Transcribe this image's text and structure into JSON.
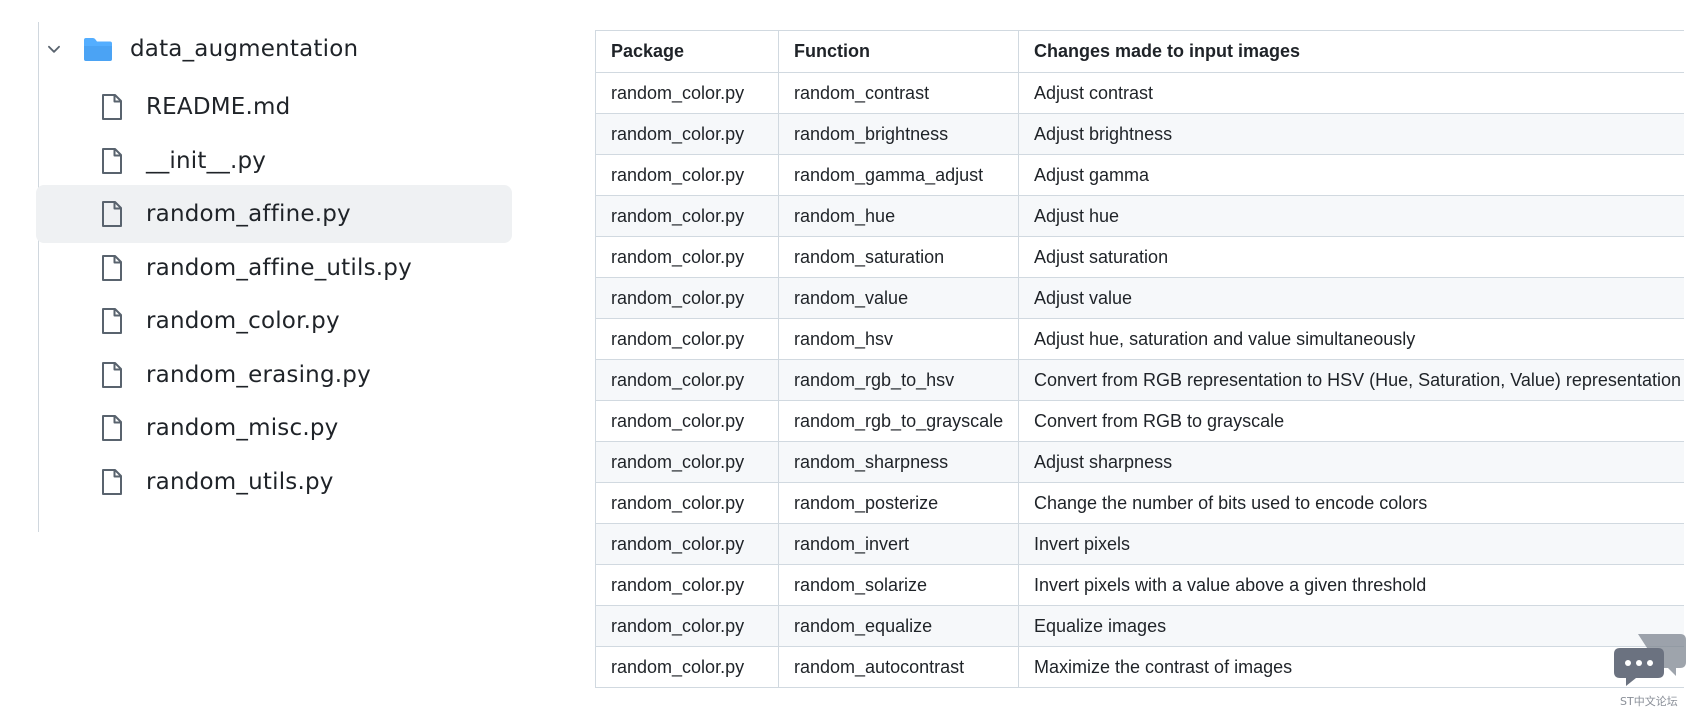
{
  "file_tree": {
    "folder": {
      "name": "data_augmentation",
      "icon": "folder-open-icon",
      "chevron": "chevron-down-icon",
      "color": "#54aeff"
    },
    "files": [
      {
        "name": "README.md",
        "selected": false
      },
      {
        "name": "__init__.py",
        "selected": false
      },
      {
        "name": "random_affine.py",
        "selected": true
      },
      {
        "name": "random_affine_utils.py",
        "selected": false
      },
      {
        "name": "random_color.py",
        "selected": false
      },
      {
        "name": "random_erasing.py",
        "selected": false
      },
      {
        "name": "random_misc.py",
        "selected": false
      },
      {
        "name": "random_utils.py",
        "selected": false
      }
    ]
  },
  "table": {
    "headers": [
      "Package",
      "Function",
      "Changes made to input images"
    ],
    "rows": [
      [
        "random_color.py",
        "random_contrast",
        "Adjust contrast"
      ],
      [
        "random_color.py",
        "random_brightness",
        "Adjust brightness"
      ],
      [
        "random_color.py",
        "random_gamma_adjust",
        "Adjust gamma"
      ],
      [
        "random_color.py",
        "random_hue",
        "Adjust hue"
      ],
      [
        "random_color.py",
        "random_saturation",
        "Adjust saturation"
      ],
      [
        "random_color.py",
        "random_value",
        "Adjust value"
      ],
      [
        "random_color.py",
        "random_hsv",
        "Adjust hue, saturation and value simultaneously"
      ],
      [
        "random_color.py",
        "random_rgb_to_hsv",
        "Convert from RGB representation to HSV (Hue, Saturation, Value) representation"
      ],
      [
        "random_color.py",
        "random_rgb_to_grayscale",
        "Convert from RGB to grayscale"
      ],
      [
        "random_color.py",
        "random_sharpness",
        "Adjust sharpness"
      ],
      [
        "random_color.py",
        "random_posterize",
        "Change the number of bits used to encode colors"
      ],
      [
        "random_color.py",
        "random_invert",
        "Invert pixels"
      ],
      [
        "random_color.py",
        "random_solarize",
        "Invert pixels with a value above a given threshold"
      ],
      [
        "random_color.py",
        "random_equalize",
        "Equalize images"
      ],
      [
        "random_color.py",
        "random_autocontrast",
        "Maximize the contrast of images"
      ]
    ]
  },
  "watermark": {
    "caption": "ST中文论坛",
    "icon": "chat-bubbles-icon"
  }
}
